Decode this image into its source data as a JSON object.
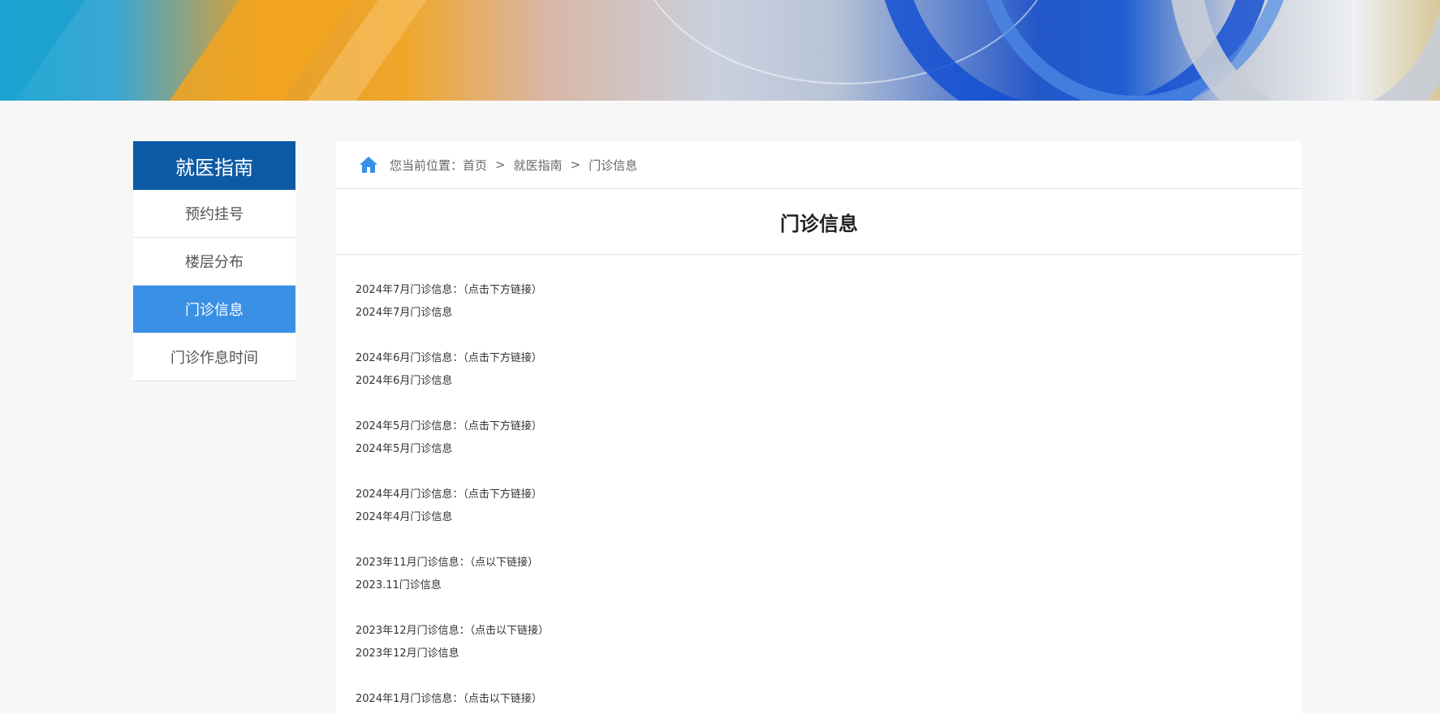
{
  "sidebar": {
    "title": "就医指南",
    "items": [
      {
        "label": "预约挂号",
        "active": false
      },
      {
        "label": "楼层分布",
        "active": false
      },
      {
        "label": "门诊信息",
        "active": true
      },
      {
        "label": "门诊作息时间",
        "active": false
      }
    ]
  },
  "breadcrumb": {
    "prefix": "您当前位置：",
    "crumbs": [
      "首页",
      "就医指南",
      "门诊信息"
    ],
    "separator": ">"
  },
  "page_title": "门诊信息",
  "entries": [
    {
      "heading": "2024年7月门诊信息：（点击下方链接）",
      "link": "2024年7月门诊信息"
    },
    {
      "heading": "2024年6月门诊信息：（点击下方链接）",
      "link": "2024年6月门诊信息"
    },
    {
      "heading": "2024年5月门诊信息：（点击下方链接）",
      "link": "2024年5月门诊信息"
    },
    {
      "heading": "2024年4月门诊信息：（点击下方链接）",
      "link": "2024年4月门诊信息"
    },
    {
      "heading": "2023年11月门诊信息：（点以下链接）",
      "link": "2023.11门诊信息"
    },
    {
      "heading": "2023年12月门诊信息：（点击以下链接）",
      "link": "2023年12月门诊信息"
    },
    {
      "heading": "2024年1月门诊信息：（点击以下链接）",
      "link": ""
    }
  ],
  "colors": {
    "sidebar_header": "#0d5aa7",
    "sidebar_active": "#3a90e5",
    "home_icon": "#3a90e5"
  },
  "icons": {
    "home": "home-icon"
  }
}
